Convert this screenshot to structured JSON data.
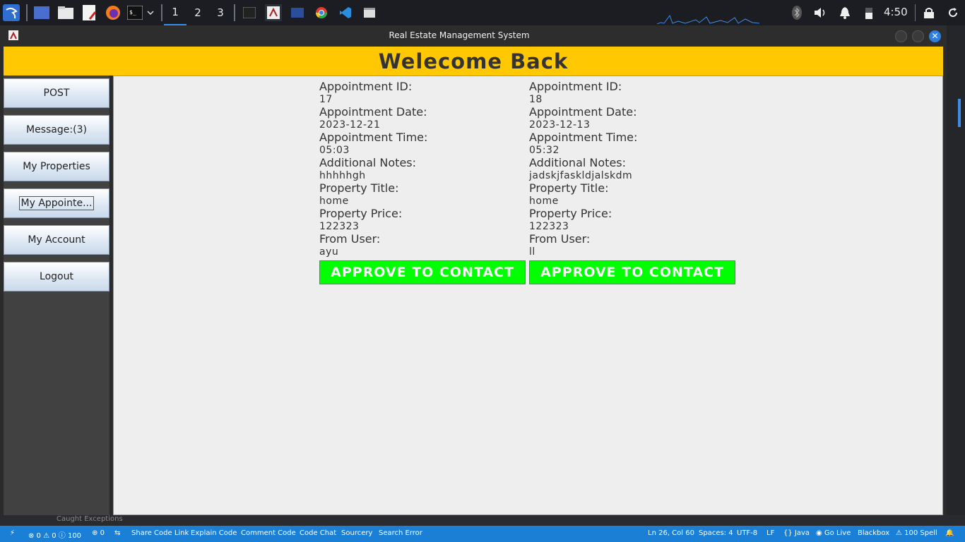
{
  "taskbar": {
    "workspaces": [
      "1",
      "2",
      "3"
    ],
    "clock": "4:50"
  },
  "window": {
    "title": "Real Estate Management System",
    "close_glyph": "✕"
  },
  "banner": {
    "text": "Welecome Back"
  },
  "sidebar": {
    "items": [
      {
        "label": "POST"
      },
      {
        "label": "Message:(3)"
      },
      {
        "label": "My Properties"
      },
      {
        "label": "My Appointe..."
      },
      {
        "label": "My Account"
      },
      {
        "label": "Logout"
      }
    ]
  },
  "appointments": [
    {
      "id_label": "Appointment ID:",
      "id": "17",
      "date_label": "Appointment Date:",
      "date": "2023-12-21",
      "time_label": "Appointment Time:",
      "time": "05:03",
      "notes_label": "Additional Notes:",
      "notes": "hhhhhgh",
      "title_label": "Property Title:",
      "title": "home",
      "price_label": "Property Price:",
      "price": "122323",
      "user_label": "From User:",
      "user": "ayu",
      "button": "APPROVE TO CONTACT"
    },
    {
      "id_label": "Appointment ID:",
      "id": "18",
      "date_label": "Appointment Date:",
      "date": "2023-12-13",
      "time_label": "Appointment Time:",
      "time": "05:32",
      "notes_label": "Additional Notes:",
      "notes": "jadskjfaskldjalskdm",
      "title_label": "Property Title:",
      "title": "home",
      "price_label": "Property Price:",
      "price": "122323",
      "user_label": "From User:",
      "user": "ll",
      "button": "APPROVE TO CONTACT"
    }
  ],
  "under_strip": {
    "text": "Caught Exceptions"
  },
  "statusbar": {
    "problems": "⊗ 0 ⚠ 0 ⓘ 100",
    "ports": "0",
    "share": "Share Code Link",
    "explain": "Explain Code",
    "comment": "Comment Code",
    "chat": "Code Chat",
    "sourcery": "Sourcery",
    "search_error": "Search Error",
    "position": "Ln 26, Col 60",
    "spaces": "Spaces: 4",
    "encoding": "UTF-8",
    "eol": "LF",
    "language": "Java",
    "golive": "Go Live",
    "blackbox": "Blackbox",
    "spell": "100 Spell"
  }
}
